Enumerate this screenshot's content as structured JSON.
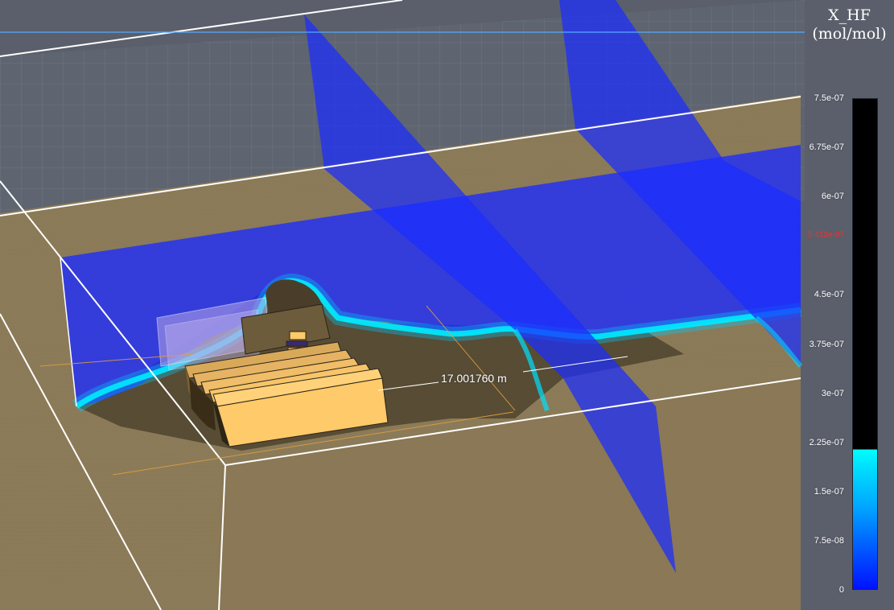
{
  "legend": {
    "variable": "X_HF",
    "unit": "(mol/mol)",
    "ticks": [
      "7.5e-07",
      "6.75e-07",
      "6e-07",
      "4.5e-07",
      "3.75e-07",
      "3e-07",
      "2.25e-07",
      "1.5e-07",
      "7.5e-08",
      "0"
    ],
    "tick_values": [
      7.5e-07,
      6.75e-07,
      6e-07,
      4.5e-07,
      3.75e-07,
      3e-07,
      2.25e-07,
      1.5e-07,
      7.5e-08,
      0
    ],
    "range": [
      0,
      7.5e-07
    ],
    "marker_label": "5.412e-07",
    "marker_value": 5.412e-07,
    "marker_color": "#ff2a2a",
    "colormap": [
      "#0012ff",
      "#0060ff",
      "#00a8ff",
      "#00ffff",
      "#000000"
    ]
  },
  "measurement": {
    "label": "17.001760  m"
  },
  "scene": {
    "background_color": "#5a5f6b",
    "ground_color": "#8c7b58",
    "building_color": "#ffca6a",
    "slice_color": "#1b2cff",
    "outline_color": "#ffffff"
  }
}
